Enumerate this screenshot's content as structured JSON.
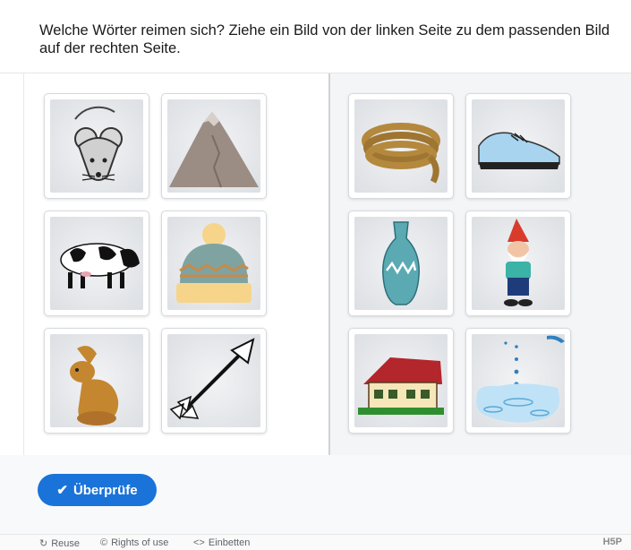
{
  "question": "Welche Wörter reimen sich? Ziehe ein Bild von der linken Seite zu dem passenden Bild auf der rechten Seite.",
  "left_cards": [
    {
      "name": "mouse",
      "icon": "mouse-icon"
    },
    {
      "name": "mountain",
      "icon": "mountain-icon"
    },
    {
      "name": "cow",
      "icon": "cow-icon"
    },
    {
      "name": "beanie-hat",
      "icon": "beanie-hat-icon"
    },
    {
      "name": "rabbit",
      "icon": "rabbit-icon"
    },
    {
      "name": "arrow",
      "icon": "arrow-icon"
    }
  ],
  "right_cards": [
    {
      "name": "rope",
      "icon": "rope-icon"
    },
    {
      "name": "shoe",
      "icon": "shoe-icon"
    },
    {
      "name": "vase",
      "icon": "vase-icon"
    },
    {
      "name": "gnome",
      "icon": "gnome-icon"
    },
    {
      "name": "house",
      "icon": "house-icon"
    },
    {
      "name": "water-drops",
      "icon": "water-drops-icon"
    }
  ],
  "check_button": {
    "label": "Überprüfe",
    "icon": "checkmark-icon"
  },
  "footer": {
    "reuse": "Reuse",
    "rights": "Rights of use",
    "embed": "Einbetten",
    "brand": "H5P"
  },
  "colors": {
    "accent": "#1a73d9",
    "divider": "#cfd2d6"
  }
}
